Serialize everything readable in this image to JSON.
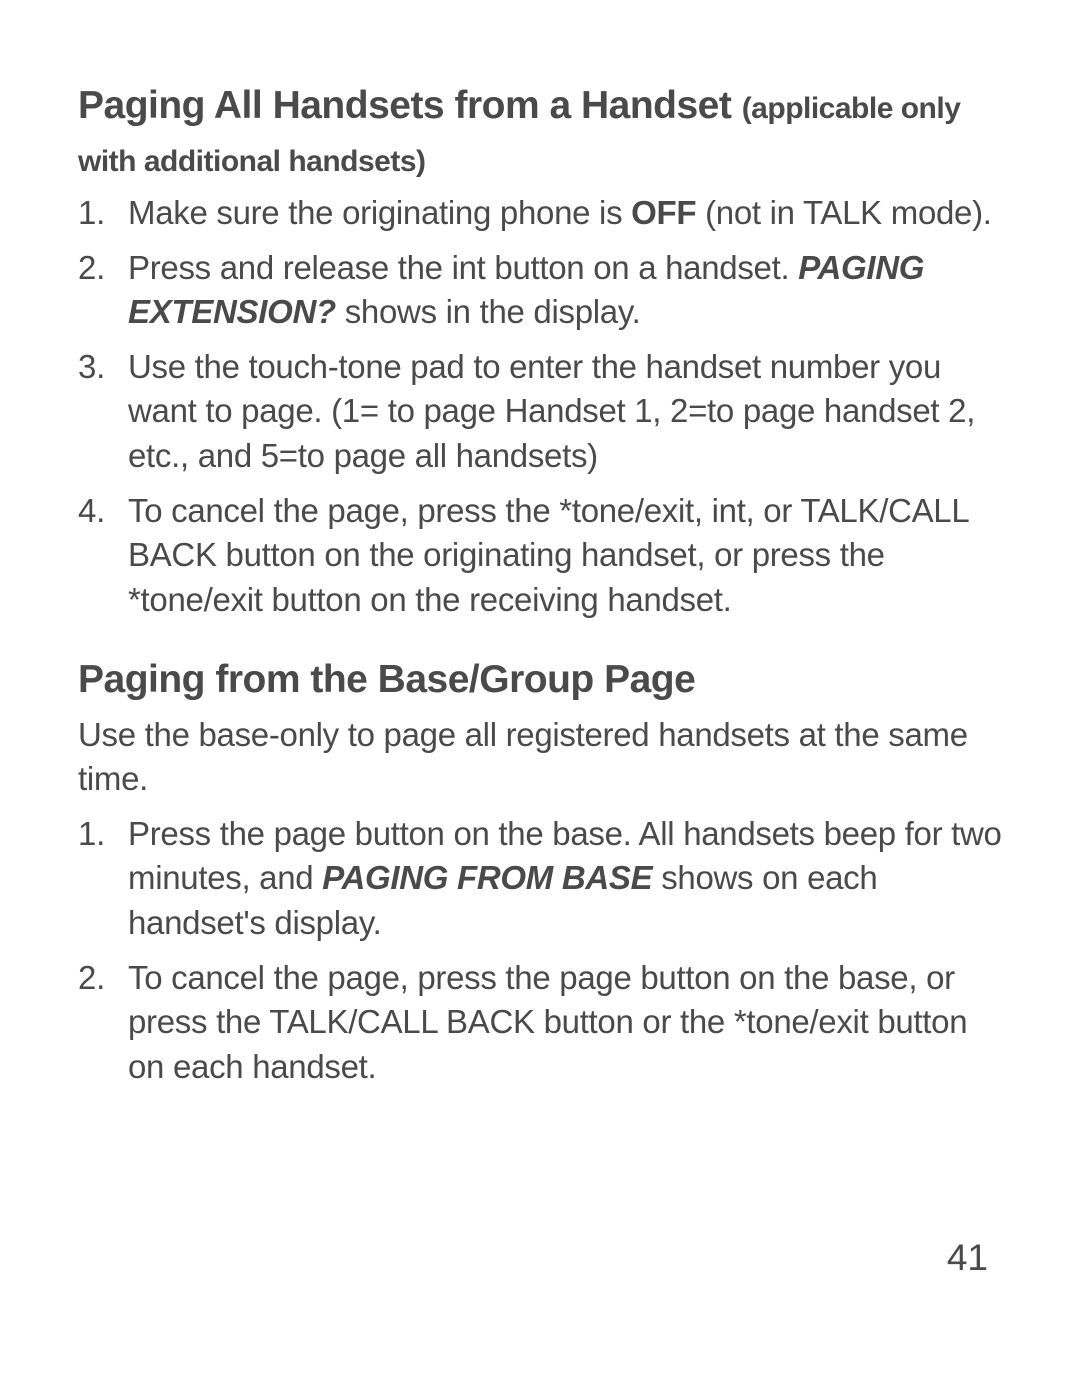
{
  "section1": {
    "heading_main": "Paging All Handsets from a Handset ",
    "heading_sub": "(applicable only with additional handsets)",
    "items": {
      "i1_a": "Make sure the originating phone is ",
      "i1_b": "OFF",
      "i1_c": " (not in TALK mode).",
      "i2_a": "Press and release the int button on a handset. ",
      "i2_b": "PAGING EXTENSION?",
      "i2_c": " shows in the display.",
      "i3": "Use the touch-tone pad to enter the handset number you want to page. (1= to page Handset 1, 2=to page handset 2, etc., and 5=to page all handsets)",
      "i4": "To cancel the page, press the *tone/exit, int, or TALK/CALL BACK button on the originating handset, or press the *tone/exit button on the receiving handset."
    }
  },
  "section2": {
    "heading": "Paging from the Base/Group Page",
    "intro": "Use the base-only to page all registered handsets at the same time.",
    "items": {
      "i1_a": "Press the page button on the base. All handsets beep for two minutes, and ",
      "i1_b": "PAGING FROM BASE",
      "i1_c": " shows on each handset's display.",
      "i2": "To cancel the page, press the page button on the base, or press the TALK/CALL BACK button or the *tone/exit button on each handset."
    }
  },
  "page_number": "41"
}
